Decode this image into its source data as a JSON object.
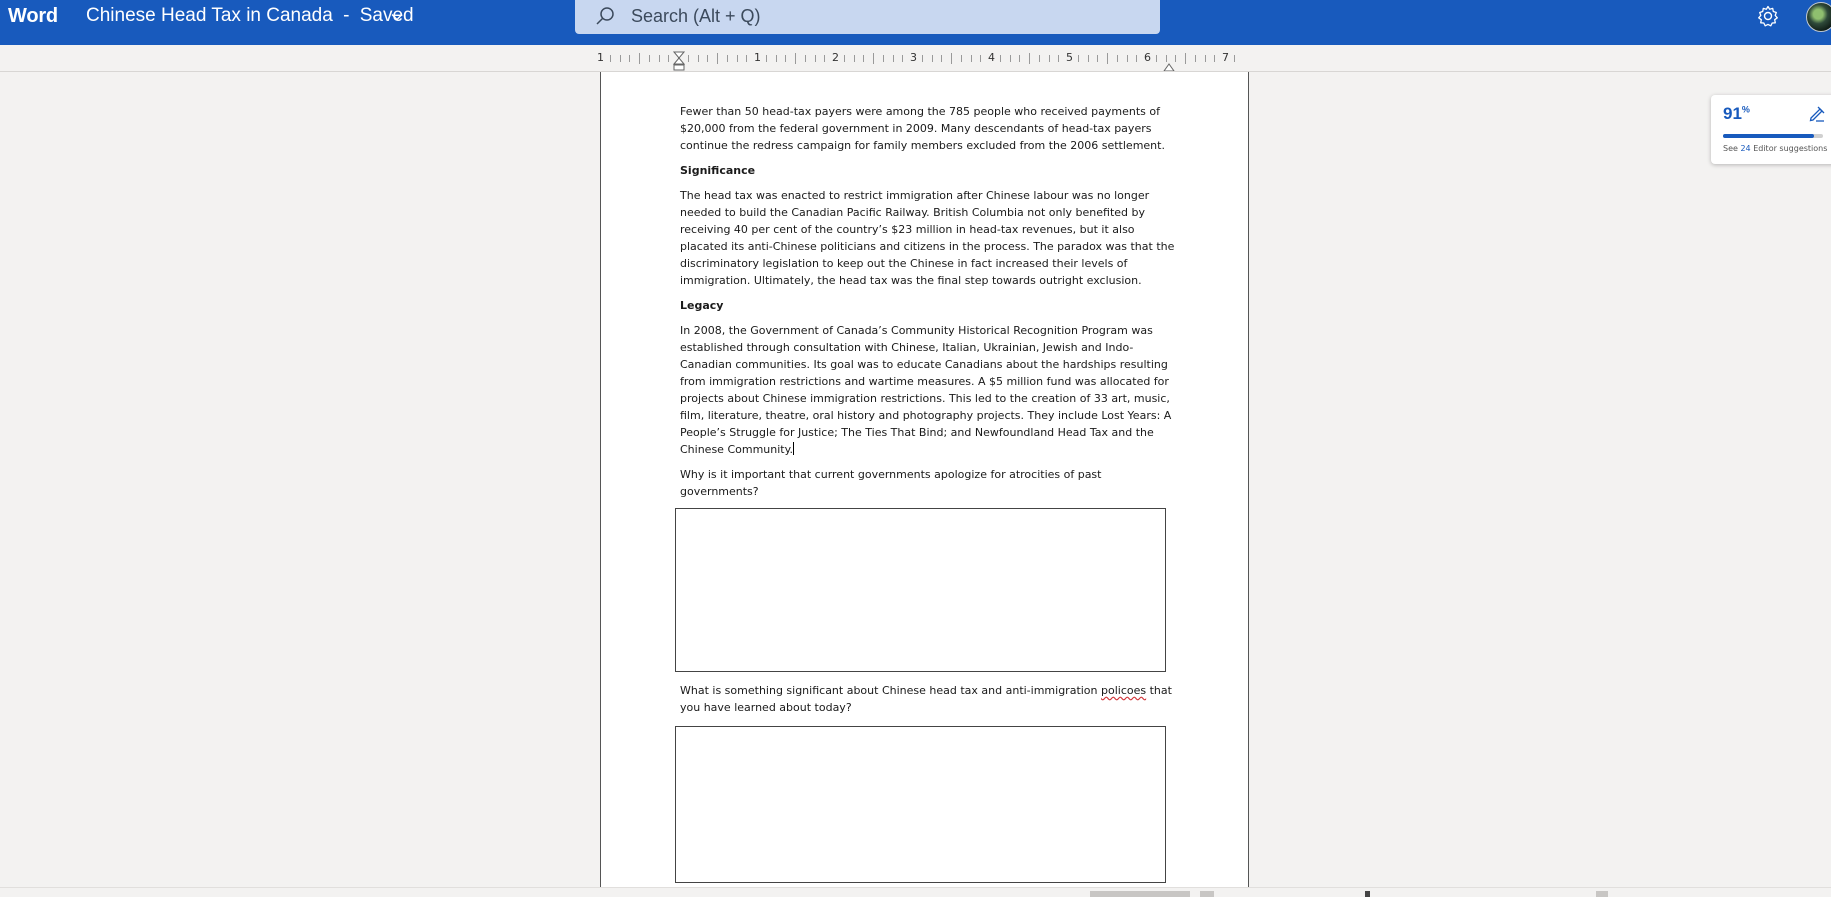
{
  "app": {
    "name": "Word",
    "doc_title": "Chinese Head Tax in Canada",
    "save_status": "Saved",
    "title_separator": "-"
  },
  "search": {
    "placeholder": "Search (Alt + Q)"
  },
  "ruler": {
    "labels": [
      "1",
      "1",
      "2",
      "3",
      "4",
      "5",
      "6",
      "7"
    ]
  },
  "editor": {
    "score": "91",
    "score_unit": "%",
    "progress": 0.91,
    "suggestions_prefix": "See",
    "suggestions_count": "24",
    "suggestions_suffix": "Editor suggestions"
  },
  "document": {
    "para1": "Fewer than 50 head-tax payers were among the 785 people who received payments of $20,000 from the federal government in 2009. Many descendants of head-tax payers continue the redress campaign for family members excluded from the 2006 settlement.",
    "heading_significance": "Significance",
    "para2": "The head tax was enacted to restrict immigration after Chinese labour was no longer needed to build the Canadian Pacific Railway. British Columbia not only benefited by receiving 40 per cent of the country’s $23 million in head-tax revenues, but it also placated its anti-Chinese politicians and citizens in the process. The paradox was that the discriminatory legislation to keep out the Chinese in fact increased their levels of immigration. Ultimately, the head tax was the final step towards outright exclusion.",
    "heading_legacy": "Legacy",
    "para3": "In 2008, the Government of Canada’s Community Historical Recognition Program was established through consultation with Chinese, Italian, Ukrainian, Jewish and Indo-Canadian communities. Its goal was to educate Canadians about the hardships resulting from immigration restrictions and wartime measures. A $5 million fund was allocated for projects about Chinese immigration restrictions. This led to the creation of 33 art, music, film, literature, theatre, oral history and photography projects. They include Lost Years: A People’s Struggle for Justice; The Ties That Bind; and Newfoundland Head Tax and the Chinese Community.",
    "question1": "Why is it important that current governments apologize for atrocities of past governments?",
    "question2_before": "What is something significant about Chinese head tax and anti-immigration ",
    "question2_misspelled": "policoes",
    "question2_after": " that you have learned about today?"
  },
  "colors": {
    "titlebar": "#185abd",
    "search_bg": "#c8d7f0",
    "canvas": "#f3f2f1",
    "accent": "#185abd",
    "spell_error": "#d13438"
  }
}
